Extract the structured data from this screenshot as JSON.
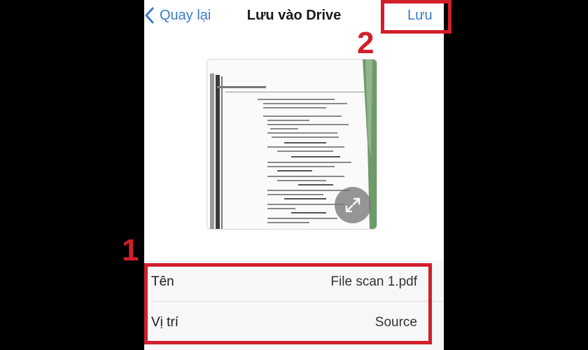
{
  "nav": {
    "back_label": "Quay lại",
    "title": "Lưu vào Drive",
    "save_label": "Lưu"
  },
  "preview": {
    "icons": {
      "expand": "expand-arrows-icon"
    }
  },
  "fields": [
    {
      "label": "Tên",
      "value": "File scan 1.pdf"
    },
    {
      "label": "Vị trí",
      "value": "Source"
    }
  ],
  "annotations": {
    "step1": "1",
    "step2": "2"
  },
  "colors": {
    "accent": "#3a7bc8",
    "annotation": "#d11f2b",
    "background": "#000000"
  }
}
